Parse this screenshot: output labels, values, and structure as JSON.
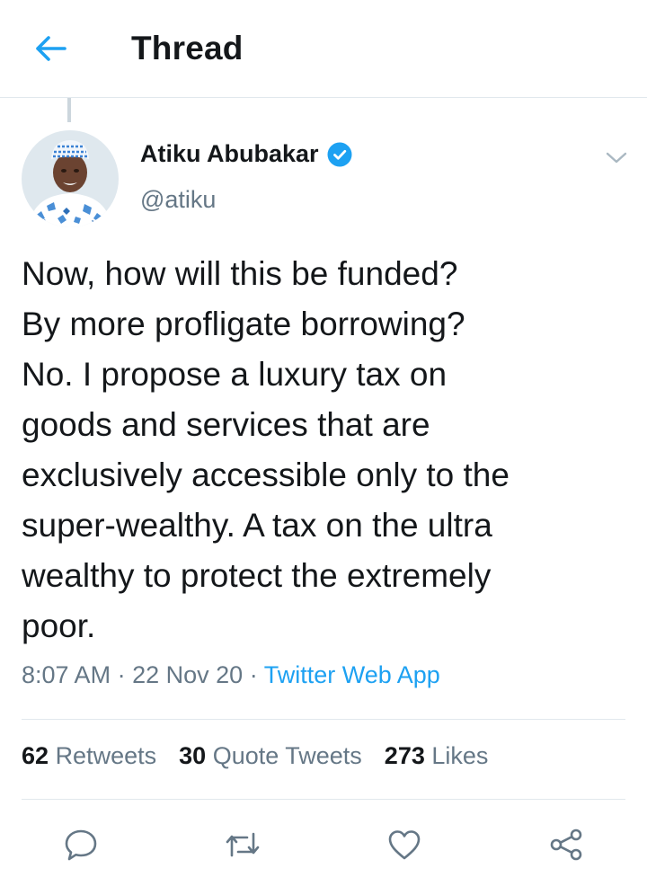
{
  "header": {
    "title": "Thread",
    "back_icon": "arrow-left-icon"
  },
  "tweet": {
    "author": {
      "name": "Atiku Abubakar",
      "handle": "@atiku",
      "verified_icon": "verified-badge-icon"
    },
    "text": "Now, how will this be funded?\nBy more profligate borrowing?\nNo. I propose a luxury tax on\ngoods and services that are\nexclusively accessible only to the\nsuper-wealthy. A tax on the ultra\nwealthy to protect the extremely\npoor.",
    "time": "8:07 AM",
    "date": "22 Nov 20",
    "separator": "·",
    "source": "Twitter Web App"
  },
  "stats": {
    "retweets": {
      "count": "62",
      "label": "Retweets"
    },
    "quotes": {
      "count": "30",
      "label": "Quote Tweets"
    },
    "likes": {
      "count": "273",
      "label": "Likes"
    }
  },
  "actions": [
    "reply-icon",
    "retweet-icon",
    "like-icon",
    "share-icon"
  ],
  "colors": {
    "accent": "#1da1f2",
    "secondary_text": "#657786",
    "divider": "#e1e8ed",
    "icon": "#657786"
  }
}
